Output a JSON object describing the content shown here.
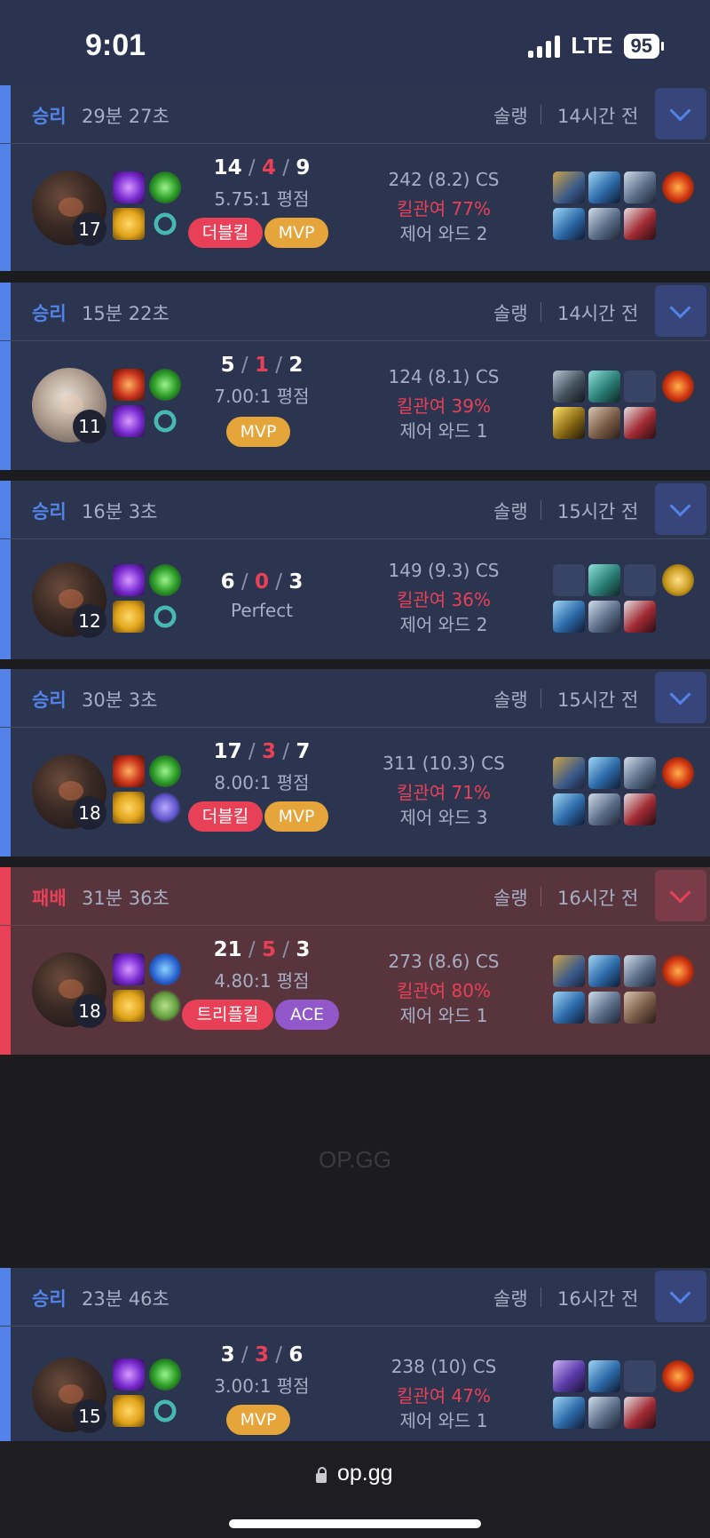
{
  "status_bar": {
    "time": "9:01",
    "network": "LTE",
    "battery": "95"
  },
  "matches": [
    {
      "result": "승리",
      "duration": "29분 27초",
      "queue": "솔랭",
      "ago": "14시간 전",
      "level": "17",
      "kills": "14",
      "deaths": "4",
      "assists": "9",
      "ratio": "5.75:1 평점",
      "badges": [
        "더블킬",
        "MVP"
      ],
      "cs": "242 (8.2) CS",
      "kill_participation": "킬관여 77%",
      "wards": "제어 와드 2"
    },
    {
      "result": "승리",
      "duration": "15분 22초",
      "queue": "솔랭",
      "ago": "14시간 전",
      "level": "11",
      "kills": "5",
      "deaths": "1",
      "assists": "2",
      "ratio": "7.00:1 평점",
      "badges": [
        "MVP"
      ],
      "cs": "124 (8.1) CS",
      "kill_participation": "킬관여 39%",
      "wards": "제어 와드 1"
    },
    {
      "result": "승리",
      "duration": "16분 3초",
      "queue": "솔랭",
      "ago": "15시간 전",
      "level": "12",
      "kills": "6",
      "deaths": "0",
      "assists": "3",
      "ratio": "Perfect",
      "badges": [],
      "cs": "149 (9.3) CS",
      "kill_participation": "킬관여 36%",
      "wards": "제어 와드 2"
    },
    {
      "result": "승리",
      "duration": "30분 3초",
      "queue": "솔랭",
      "ago": "15시간 전",
      "level": "18",
      "kills": "17",
      "deaths": "3",
      "assists": "7",
      "ratio": "8.00:1 평점",
      "badges": [
        "더블킬",
        "MVP"
      ],
      "cs": "311 (10.3) CS",
      "kill_participation": "킬관여 71%",
      "wards": "제어 와드 3"
    },
    {
      "result": "패배",
      "duration": "31분 36초",
      "queue": "솔랭",
      "ago": "16시간 전",
      "level": "18",
      "kills": "21",
      "deaths": "5",
      "assists": "3",
      "ratio": "4.80:1 평점",
      "badges": [
        "트리플킬",
        "ACE"
      ],
      "cs": "273 (8.6) CS",
      "kill_participation": "킬관여 80%",
      "wards": "제어 와드 1"
    },
    {
      "result": "승리",
      "duration": "23분 46초",
      "queue": "솔랭",
      "ago": "16시간 전",
      "level": "15",
      "kills": "3",
      "deaths": "3",
      "assists": "6",
      "ratio": "3.00:1 평점",
      "badges": [
        "MVP"
      ],
      "cs": "238 (10) CS",
      "kill_participation": "킬관여 47%",
      "wards": "제어 와드 1"
    }
  ],
  "ad": {
    "logo": "OP.GG"
  },
  "browser": {
    "url": "op.gg"
  },
  "colors": {
    "win": "#5383e8",
    "loss": "#e84057",
    "mvp": "#e5a53a",
    "ace": "#9257c8"
  },
  "icons": {
    "expand": "chevron-down-icon",
    "lock": "lock-icon"
  }
}
